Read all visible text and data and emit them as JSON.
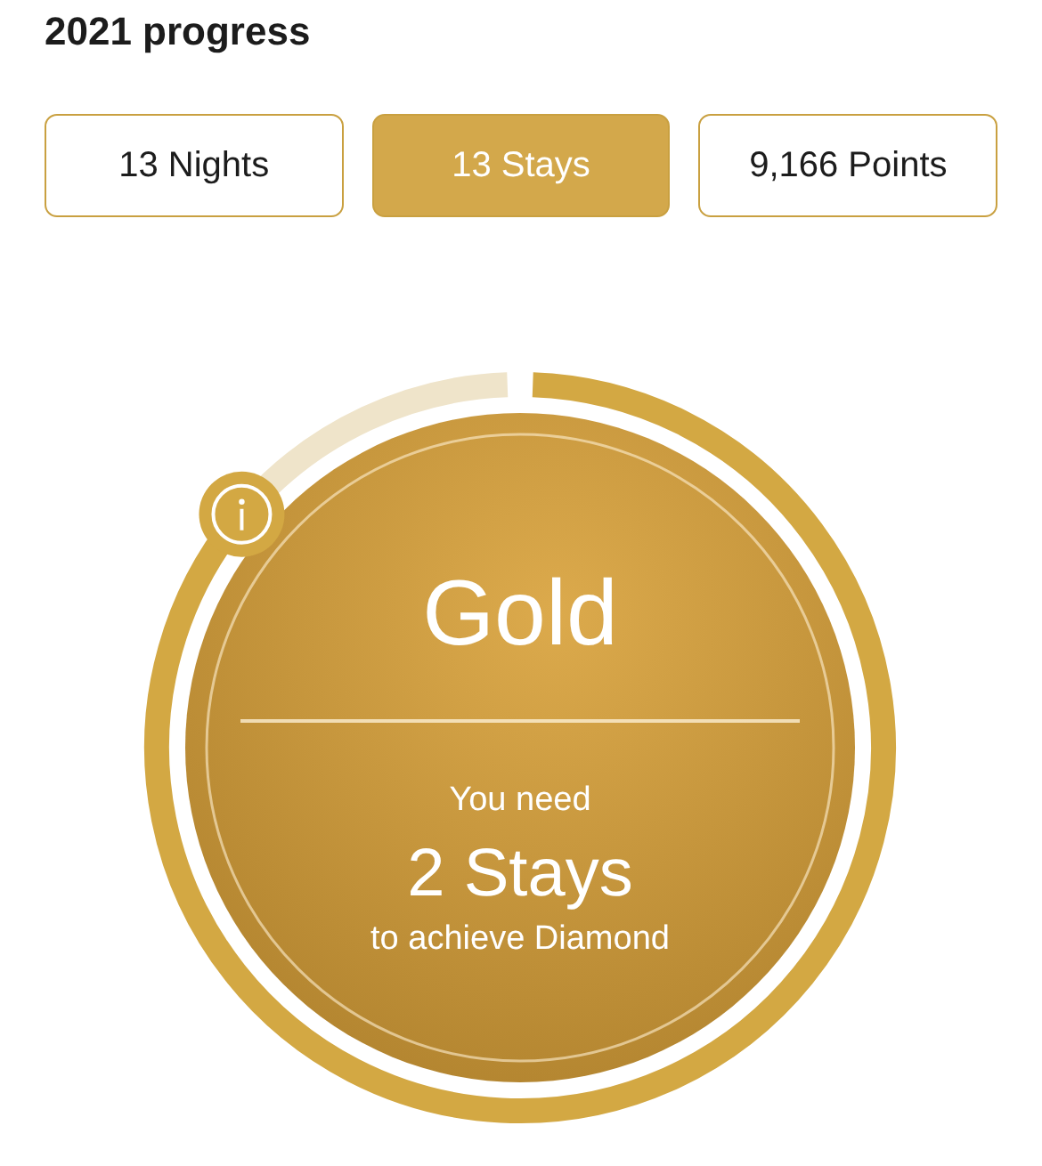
{
  "title": "2021 progress",
  "tabs": [
    {
      "label": "13 Nights",
      "selected": false
    },
    {
      "label": "13 Stays",
      "selected": true
    },
    {
      "label": "9,166 Points",
      "selected": false
    }
  ],
  "tier": {
    "name": "Gold",
    "need_label": "You need",
    "amount": "2 Stays",
    "goal_label": "to achieve Diamond"
  }
}
